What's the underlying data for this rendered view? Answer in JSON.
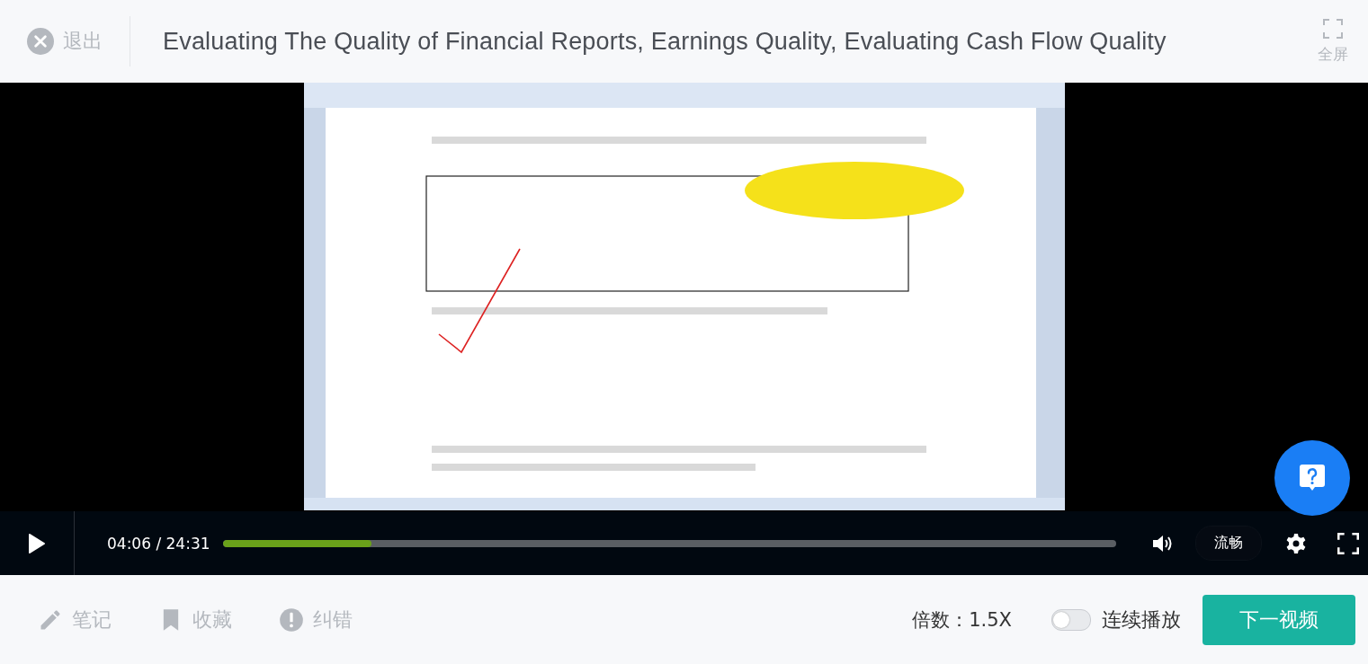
{
  "header": {
    "exit_label": "退出",
    "title": "Evaluating The Quality of Financial Reports, Earnings Quality, Evaluating Cash Flow Quality",
    "fullscreen_label": "全屏"
  },
  "controls": {
    "playing": false,
    "time": "04:06 / 24:31",
    "progress": {
      "level": 0.167
    },
    "quality": "流畅"
  },
  "footer": {
    "actions": [
      {
        "label": "笔记",
        "kind": "note"
      },
      {
        "label": "收藏",
        "kind": "favorite"
      },
      {
        "label": "纠错",
        "kind": "report"
      }
    ],
    "speed": "倍数：1.5X",
    "autoplay": {
      "label": "连续播放",
      "on": false
    },
    "next_button": "下一视频"
  }
}
